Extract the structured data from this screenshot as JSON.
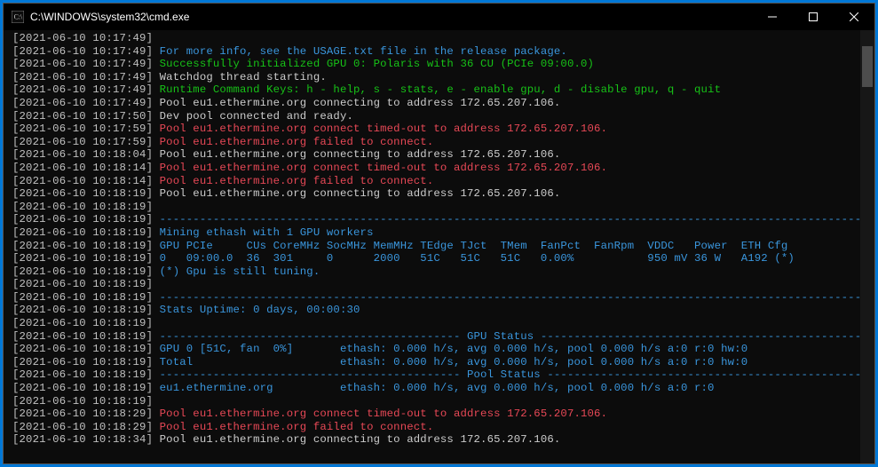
{
  "window": {
    "title": "C:\\WINDOWS\\system32\\cmd.exe"
  },
  "lines": [
    {
      "ts": "[2021-06-10 10:17:49]",
      "segs": []
    },
    {
      "ts": "[2021-06-10 10:17:49]",
      "segs": [
        {
          "cls": "cyan",
          "t": "For more info, see the USAGE.txt file in the release package."
        }
      ]
    },
    {
      "ts": "[2021-06-10 10:17:49]",
      "segs": [
        {
          "cls": "green",
          "t": "Successfully initialized GPU 0: Polaris with 36 CU (PCIe 09:00.0)"
        }
      ]
    },
    {
      "ts": "[2021-06-10 10:17:49]",
      "segs": [
        {
          "cls": "white",
          "t": "Watchdog thread starting."
        }
      ]
    },
    {
      "ts": "[2021-06-10 10:17:49]",
      "segs": [
        {
          "cls": "green",
          "t": "Runtime Command Keys: h - help, s - stats, e - enable gpu, d - disable gpu, q - quit"
        }
      ]
    },
    {
      "ts": "[2021-06-10 10:17:49]",
      "segs": [
        {
          "cls": "white",
          "t": "Pool eu1.ethermine.org connecting to address 172.65.207.106."
        }
      ]
    },
    {
      "ts": "[2021-06-10 10:17:50]",
      "segs": [
        {
          "cls": "white",
          "t": "Dev pool connected and ready."
        }
      ]
    },
    {
      "ts": "[2021-06-10 10:17:59]",
      "segs": [
        {
          "cls": "red",
          "t": "Pool eu1.ethermine.org connect timed-out to address 172.65.207.106."
        }
      ]
    },
    {
      "ts": "[2021-06-10 10:17:59]",
      "segs": [
        {
          "cls": "red",
          "t": "Pool eu1.ethermine.org failed to connect."
        }
      ]
    },
    {
      "ts": "[2021-06-10 10:18:04]",
      "segs": [
        {
          "cls": "white",
          "t": "Pool eu1.ethermine.org connecting to address 172.65.207.106."
        }
      ]
    },
    {
      "ts": "[2021-06-10 10:18:14]",
      "segs": [
        {
          "cls": "red",
          "t": "Pool eu1.ethermine.org connect timed-out to address 172.65.207.106."
        }
      ]
    },
    {
      "ts": "[2021-06-10 10:18:14]",
      "segs": [
        {
          "cls": "red",
          "t": "Pool eu1.ethermine.org failed to connect."
        }
      ]
    },
    {
      "ts": "[2021-06-10 10:18:19]",
      "segs": [
        {
          "cls": "white",
          "t": "Pool eu1.ethermine.org connecting to address 172.65.207.106."
        }
      ]
    },
    {
      "ts": "[2021-06-10 10:18:19]",
      "segs": []
    },
    {
      "ts": "[2021-06-10 10:18:19]",
      "segs": [
        {
          "cls": "cyan",
          "t": "---------------------------------------------------------------------------------------------------------"
        }
      ]
    },
    {
      "ts": "[2021-06-10 10:18:19]",
      "segs": [
        {
          "cls": "cyan",
          "t": "Mining ethash with 1 GPU workers"
        }
      ]
    },
    {
      "ts": "[2021-06-10 10:18:19]",
      "segs": [
        {
          "cls": "cyan",
          "t": "GPU PCIe     CUs CoreMHz SocMHz MemMHz TEdge TJct  TMem  FanPct  FanRpm  VDDC   Power  ETH Cfg"
        }
      ]
    },
    {
      "ts": "[2021-06-10 10:18:19]",
      "segs": [
        {
          "cls": "cyan",
          "t": "0   09:00.0  36  301     0      2000   51C   51C   51C   0.00%           950 mV 36 W   A192 (*)"
        }
      ]
    },
    {
      "ts": "[2021-06-10 10:18:19]",
      "segs": [
        {
          "cls": "cyan",
          "t": "(*) Gpu is still tuning."
        }
      ]
    },
    {
      "ts": "[2021-06-10 10:18:19]",
      "segs": []
    },
    {
      "ts": "[2021-06-10 10:18:19]",
      "segs": [
        {
          "cls": "cyan",
          "t": "---------------------------------------------------------------------------------------------------------"
        }
      ]
    },
    {
      "ts": "[2021-06-10 10:18:19]",
      "segs": [
        {
          "cls": "cyan",
          "t": "Stats Uptime: 0 days, 00:00:30"
        }
      ]
    },
    {
      "ts": "[2021-06-10 10:18:19]",
      "segs": []
    },
    {
      "ts": "[2021-06-10 10:18:19]",
      "segs": [
        {
          "cls": "cyan",
          "t": "--------------------------------------------- GPU Status ------------------------------------------------"
        }
      ]
    },
    {
      "ts": "[2021-06-10 10:18:19]",
      "segs": [
        {
          "cls": "cyan",
          "t": "GPU 0 [51C, fan  0%]       ethash: 0.000 h/s, avg 0.000 h/s, pool 0.000 h/s a:0 r:0 hw:0"
        }
      ]
    },
    {
      "ts": "[2021-06-10 10:18:19]",
      "segs": [
        {
          "cls": "cyan",
          "t": "Total                      ethash: 0.000 h/s, avg 0.000 h/s, pool 0.000 h/s a:0 r:0 hw:0"
        }
      ]
    },
    {
      "ts": "[2021-06-10 10:18:19]",
      "segs": [
        {
          "cls": "cyan",
          "t": "--------------------------------------------- Pool Status -----------------------------------------------"
        }
      ]
    },
    {
      "ts": "[2021-06-10 10:18:19]",
      "segs": [
        {
          "cls": "cyan",
          "t": "eu1.ethermine.org          ethash: 0.000 h/s, avg 0.000 h/s, pool 0.000 h/s a:0 r:0"
        }
      ]
    },
    {
      "ts": "[2021-06-10 10:18:19]",
      "segs": []
    },
    {
      "ts": "[2021-06-10 10:18:29]",
      "segs": [
        {
          "cls": "red",
          "t": "Pool eu1.ethermine.org connect timed-out to address 172.65.207.106."
        }
      ]
    },
    {
      "ts": "[2021-06-10 10:18:29]",
      "segs": [
        {
          "cls": "red",
          "t": "Pool eu1.ethermine.org failed to connect."
        }
      ]
    },
    {
      "ts": "[2021-06-10 10:18:34]",
      "segs": [
        {
          "cls": "white",
          "t": "Pool eu1.ethermine.org connecting to address 172.65.207.106."
        }
      ]
    }
  ]
}
